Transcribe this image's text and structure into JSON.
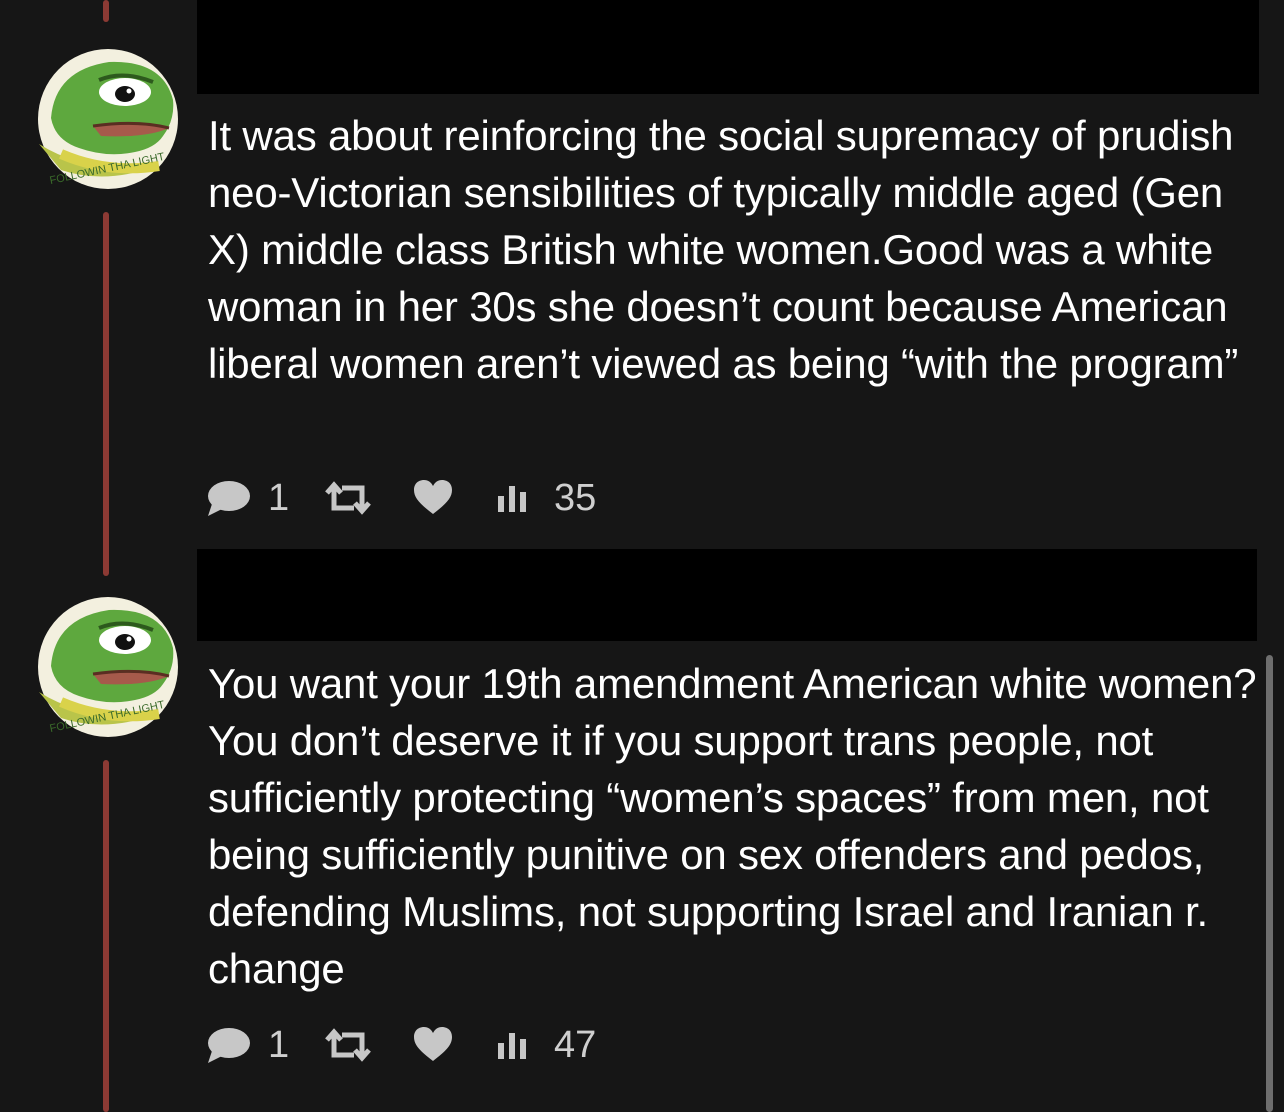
{
  "posts": [
    {
      "text": "It was about reinforcing the social supremacy of prudish neo-Victorian sensibilities of typically middle aged (Gen X) middle class British white women.Good was a white woman in her 30s she doesn’t count because American liberal women aren’t viewed as being “with the program”",
      "replies": "1",
      "views": "35",
      "avatar_badge_text": "FOLLOWIN THA LIGHT"
    },
    {
      "text": "You want your 19th amendment American white women? You don’t deserve it if you support trans people, not sufficiently protecting “women’s spaces” from men, not being sufficiently punitive on sex offenders and pedos, defending Muslims, not supporting Israel and Iranian r. change",
      "replies": "1",
      "views": "47",
      "avatar_badge_text": "FOLLOWIN THA LIGHT"
    }
  ],
  "icons": {
    "reply": "speech-bubble-icon",
    "repost": "repost-arrows-icon",
    "like": "heart-icon",
    "views": "bar-chart-icon"
  },
  "colors": {
    "background": "#161616",
    "thread_line": "#8c3a34",
    "text": "#ffffff",
    "action_icons": "#c7c7c7",
    "redaction": "#000000"
  }
}
